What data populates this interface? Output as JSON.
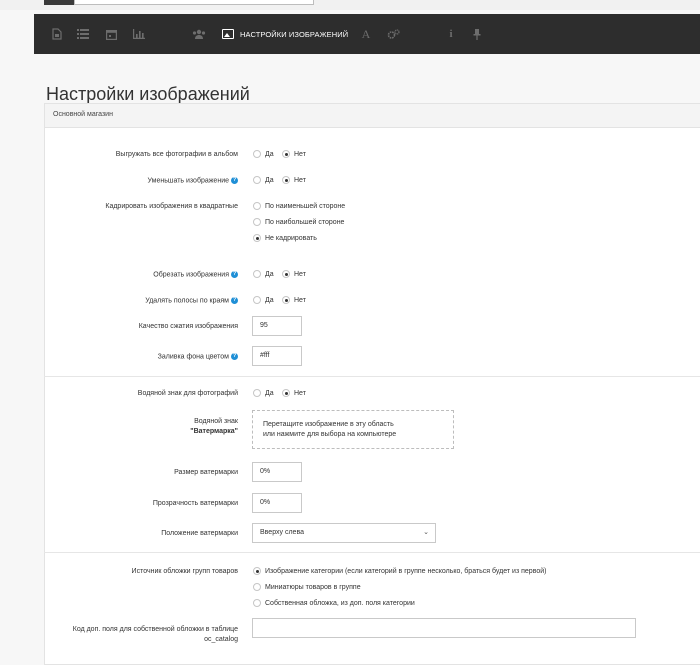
{
  "toolbar": {
    "active_label": "НАСТРОЙКИ ИЗОБРАЖЕНИЙ",
    "icons": [
      "file-icon",
      "list-icon",
      "calendar-icon",
      "chart-icon",
      "users-icon",
      "image-icon",
      "font-icon",
      "cogs-icon",
      "info-icon",
      "pin-icon"
    ]
  },
  "page": {
    "title": "Настройки изображений"
  },
  "panel": {
    "heading": "Основной магазин"
  },
  "settings": {
    "album_upload": {
      "label": "Выгружать все фотографии в альбом",
      "yes": "Да",
      "no": "Нет",
      "value": "no"
    },
    "reduce_image": {
      "label": "Уменьшать изображение",
      "yes": "Да",
      "no": "Нет",
      "value": "no"
    },
    "crop_square": {
      "label": "Кадрировать изображения в квадратные",
      "options": [
        "По наименьшей стороне",
        "По наибольшей стороне",
        "Не кадрировать"
      ],
      "selected": 2
    },
    "trim_image": {
      "label": "Обрезать изображения",
      "yes": "Да",
      "no": "Нет",
      "value": "no"
    },
    "remove_borders": {
      "label": "Удалять полосы по краям",
      "yes": "Да",
      "no": "Нет",
      "value": "no"
    },
    "compression_quality": {
      "label": "Качество сжатия изображения",
      "value": "95"
    },
    "fill_color": {
      "label": "Заливка фона цветом",
      "value": "#fff"
    },
    "watermark_enabled": {
      "label": "Водяной знак для фотографий",
      "yes": "Да",
      "no": "Нет",
      "value": "no"
    },
    "watermark_image": {
      "label_line1": "Водяной знак",
      "label_line2": "\"Ватермарка\"",
      "drop_line1": "Перетащите изображение в эту область",
      "drop_line2": "или нажмите для выбора на компьютере"
    },
    "watermark_size": {
      "label": "Размер ватермарки",
      "value": "0%"
    },
    "watermark_opacity": {
      "label": "Прозрачность ватермарки",
      "value": "0%"
    },
    "watermark_position": {
      "label": "Положение ватермарки",
      "value": "Вверху слева"
    },
    "cover_source": {
      "label": "Источник обложки групп товаров",
      "options": [
        "Изображение категории (если категорий в группе несколько, браться будет из первой)",
        "Миниатюры товаров в группе",
        "Собственная обложка, из доп. поля категории"
      ],
      "selected": 0
    },
    "custom_cover_field": {
      "label_line1": "Код доп. поля для собственной обложки в таблице",
      "label_line2": "oc_catalog",
      "value": ""
    }
  },
  "colors": {
    "toolbar_bg": "#2d2d2d",
    "help_icon": "#1f8fd6"
  }
}
